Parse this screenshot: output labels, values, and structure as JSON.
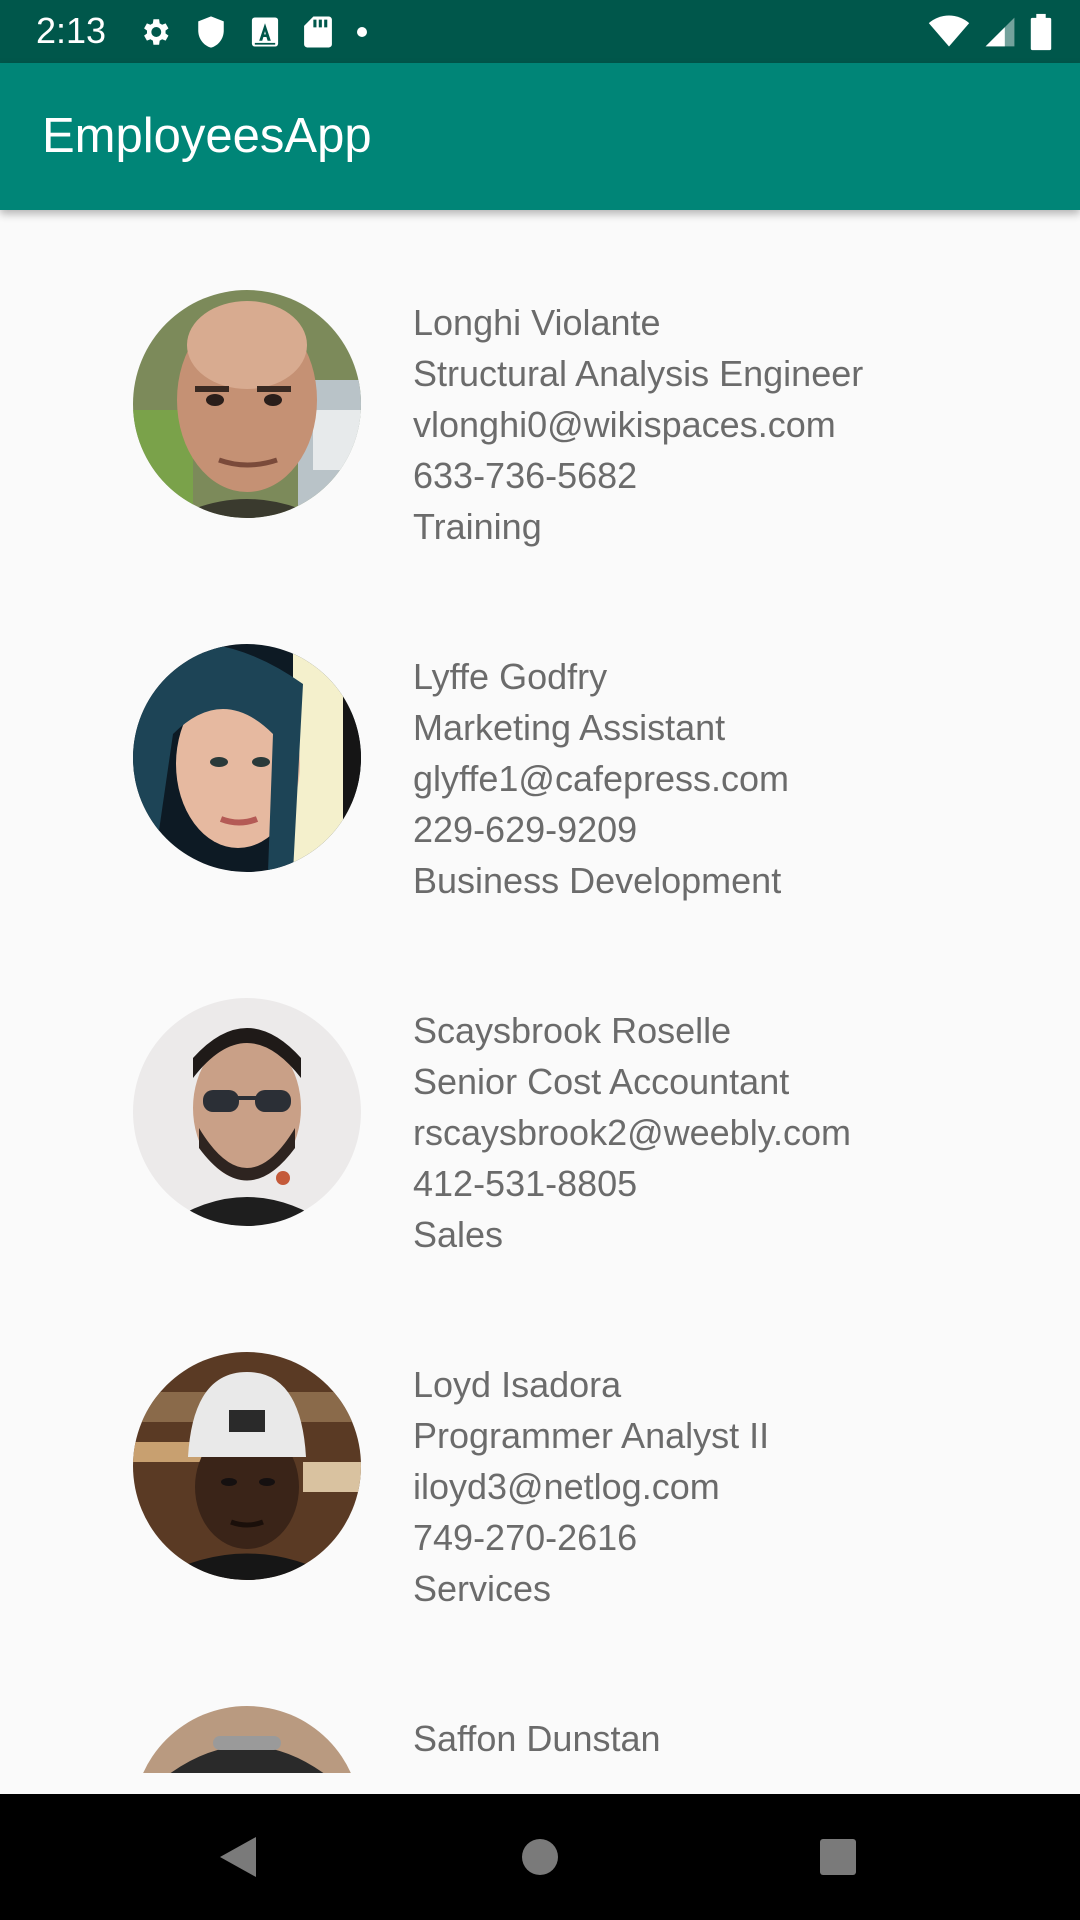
{
  "status_bar": {
    "time": "2:13",
    "left_icons": [
      "gear-icon",
      "shield-icon",
      "font-a-icon",
      "sd-card-icon",
      "dot-icon"
    ],
    "right_icons": [
      "wifi-icon",
      "signal-icon",
      "battery-icon"
    ]
  },
  "app_bar": {
    "title": "EmployeesApp",
    "color": "#008577"
  },
  "employees": [
    {
      "name": "Longhi Violante",
      "title": "Structural Analysis Engineer",
      "email": "vlonghi0@wikispaces.com",
      "phone": "633-736-5682",
      "department": "Training"
    },
    {
      "name": "Lyffe Godfry",
      "title": "Marketing Assistant",
      "email": "glyffe1@cafepress.com",
      "phone": "229-629-9209",
      "department": "Business Development"
    },
    {
      "name": "Scaysbrook Roselle",
      "title": "Senior Cost Accountant",
      "email": "rscaysbrook2@weebly.com",
      "phone": "412-531-8805",
      "department": "Sales"
    },
    {
      "name": "Loyd Isadora",
      "title": "Programmer Analyst II",
      "email": "iloyd3@netlog.com",
      "phone": "749-270-2616",
      "department": "Services"
    },
    {
      "name": "Saffon Dunstan",
      "title": "",
      "email": "",
      "phone": "",
      "department": ""
    }
  ],
  "nav_bar": {
    "buttons": [
      "back-icon",
      "home-icon",
      "recents-icon"
    ]
  }
}
